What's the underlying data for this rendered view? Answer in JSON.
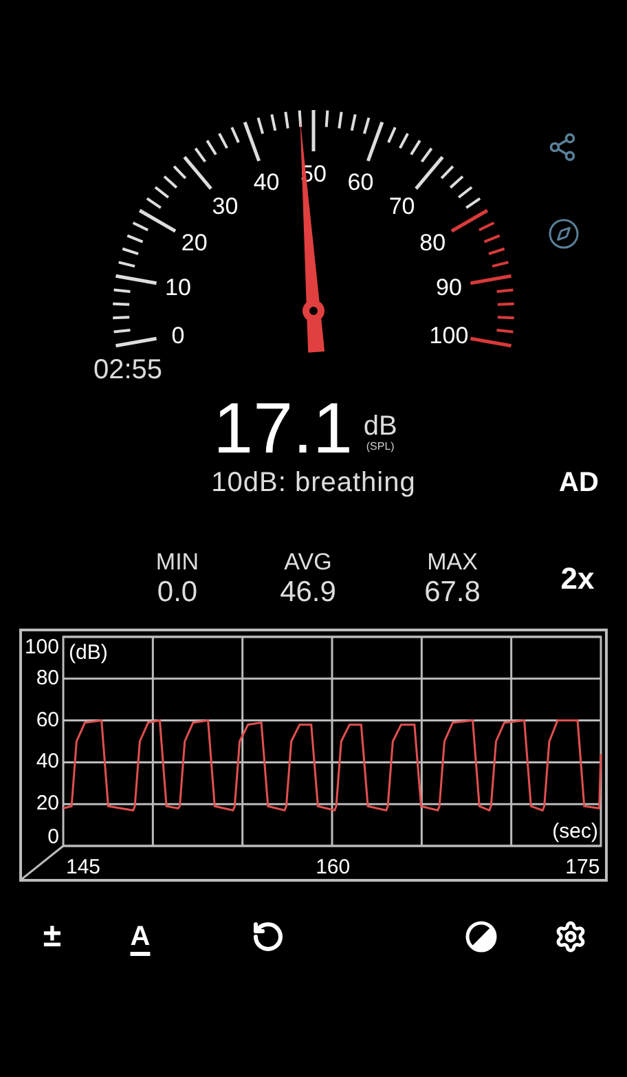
{
  "gauge": {
    "top_label": "50",
    "left_labels": [
      "40",
      "30",
      "20",
      "10",
      "0"
    ],
    "right_labels": [
      "60",
      "70",
      "80",
      "90",
      "100"
    ]
  },
  "timer": "02:55",
  "reading": {
    "value": "17.1",
    "unit": "dB",
    "weighting": "(SPL)"
  },
  "description": "10dB: breathing",
  "ad_button": "AD",
  "stats": [
    {
      "label": "MIN",
      "value": "0.0"
    },
    {
      "label": "AVG",
      "value": "46.9"
    },
    {
      "label": "MAX",
      "value": "67.8"
    }
  ],
  "zoom_button": "2x",
  "chart_data": {
    "type": "line",
    "xlabel": "(sec)",
    "ylabel": "(dB)",
    "xlim": [
      143.8,
      176.1
    ],
    "ylim": [
      0,
      100
    ],
    "xticks": [
      145,
      160,
      175
    ],
    "yticks": [
      0,
      20,
      40,
      60,
      80,
      100
    ],
    "grid": true,
    "x": [
      143.8,
      144.3,
      144.6,
      145.1,
      146.1,
      146.5,
      148.0,
      148.1,
      148.4,
      148.9,
      149.6,
      150.0,
      150.7,
      150.8,
      151.1,
      151.6,
      152.5,
      152.9,
      154.0,
      154.1,
      154.4,
      154.9,
      155.7,
      156.1,
      157.1,
      157.2,
      157.5,
      158.0,
      158.7,
      159.1,
      160.1,
      160.2,
      160.5,
      161.0,
      161.7,
      162.1,
      163.2,
      163.3,
      163.6,
      164.1,
      164.9,
      165.3,
      166.3,
      166.4,
      166.7,
      167.2,
      168.4,
      168.8,
      169.4,
      169.5,
      169.8,
      170.3,
      171.5,
      171.9,
      172.6,
      172.7,
      173.0,
      173.5,
      174.7,
      175.1,
      176.0,
      176.1
    ],
    "series": [
      {
        "color": "#e05050",
        "values": [
          18,
          19,
          50,
          59,
          60,
          19,
          17,
          19,
          50,
          59,
          60,
          19,
          18,
          19,
          50,
          59,
          60,
          19,
          17,
          19,
          50,
          58,
          59,
          19,
          17,
          19,
          50,
          58,
          58,
          19,
          17,
          19,
          50,
          58,
          58,
          19,
          17,
          19,
          50,
          58,
          58,
          19,
          17,
          19,
          50,
          59,
          60,
          19,
          17,
          19,
          50,
          59,
          60,
          19,
          17,
          19,
          50,
          60,
          60,
          19,
          18,
          44
        ]
      }
    ]
  },
  "toolbar": [
    {
      "kind": "glyph",
      "label": "±"
    },
    {
      "kind": "underlined",
      "label": "A"
    },
    {
      "kind": "reset"
    },
    {
      "kind": "contrast"
    },
    {
      "kind": "settings"
    }
  ]
}
